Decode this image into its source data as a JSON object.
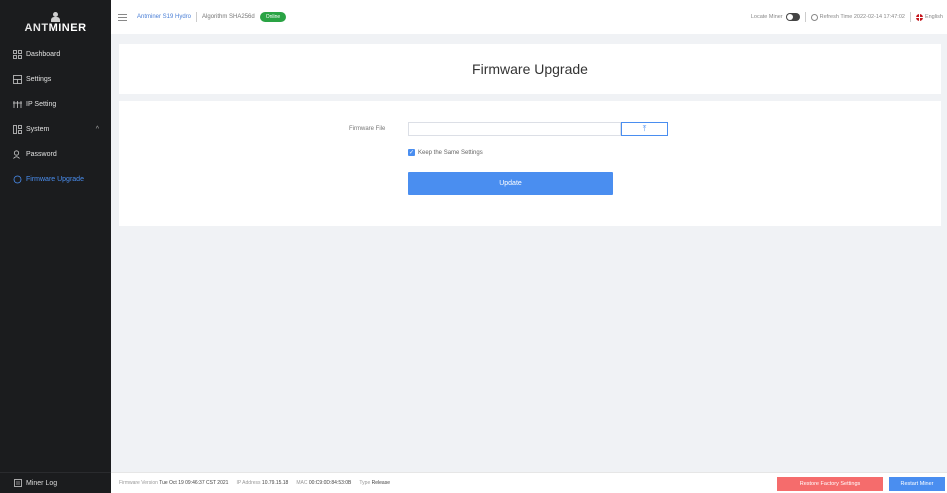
{
  "brand": {
    "prefix": "ANT",
    "highlight": "MINER"
  },
  "sidebar": {
    "items": [
      {
        "label": "Dashboard",
        "icon": "dashboard-icon"
      },
      {
        "label": "Settings",
        "icon": "settings-icon"
      },
      {
        "label": "IP Setting",
        "icon": "ip-setting-icon"
      },
      {
        "label": "System",
        "icon": "system-icon"
      },
      {
        "label": "Password",
        "icon": "password-icon"
      },
      {
        "label": "Firmware Upgrade",
        "icon": "firmware-icon"
      }
    ],
    "footer_label": "Miner Log"
  },
  "topbar": {
    "model": "Antminer S19 Hydro",
    "algorithm": "Algorithm SHA256d",
    "status": "Online",
    "locate_label": "Locate Miner",
    "refresh_label": "Refresh Time 2022-02-14 17:47:02",
    "language": "English"
  },
  "main": {
    "title": "Firmware Upgrade",
    "file_label": "Firmware File",
    "upload_icon": "⤒",
    "keep_label": "Keep the Same Settings",
    "update_label": "Update"
  },
  "footer": {
    "fw_label": "Firmware Version",
    "fw_value": "Tue Oct 19 09:46:37 CST 2021",
    "ip_label": "IP Address",
    "ip_value": "10.79.15.18",
    "mac_label": "MAC",
    "mac_value": "00:C9:0D:84:53:0B",
    "type_label": "Type",
    "type_value": "Release",
    "restore_label": "Restore Factory Settings",
    "restart_label": "Restart Miner"
  },
  "colors": {
    "accent": "#4a8ef0",
    "danger": "#f56c6c",
    "online": "#2aa344",
    "sidebar": "#1b1c1e"
  }
}
